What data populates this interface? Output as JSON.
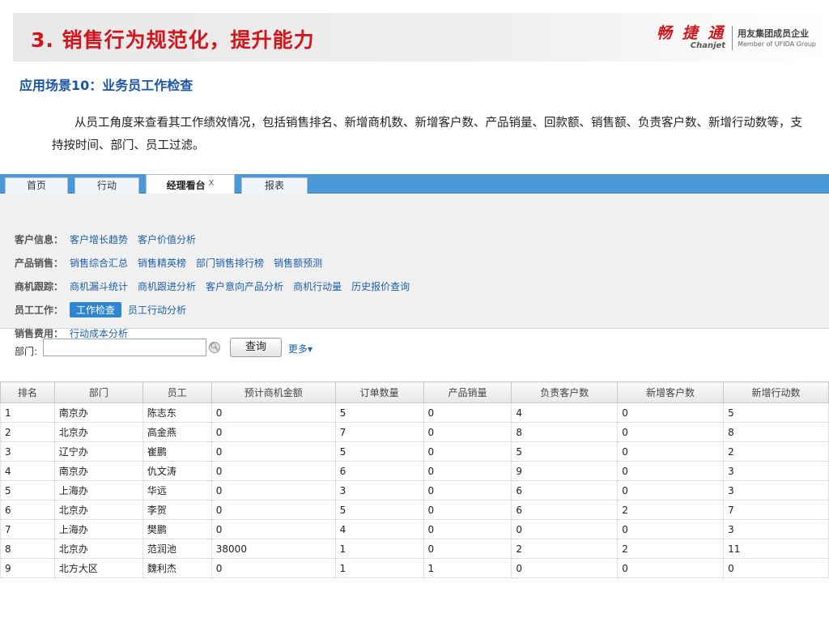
{
  "header": {
    "title": "3. 销售行为规范化，提升能力",
    "logo": {
      "name": "畅 捷 通",
      "sub": "Chanjet",
      "group_cn": "用友集团成员企业",
      "group_en": "Member of UFIDA Group"
    }
  },
  "subtitle": "应用场景10：业务员工作检查",
  "paragraph": "从员工角度来查看其工作绩效情况，包括销售排名、新增商机数、新增客户数、产品销量、回款额、销售额、负责客户数、新增行动数等，支持按时间、部门、员工过滤。",
  "tabs": [
    {
      "label": "首页"
    },
    {
      "label": "行动"
    },
    {
      "label": "经理看台",
      "close": "X"
    },
    {
      "label": "报表"
    }
  ],
  "nav": {
    "row1": {
      "label": "客户信息：",
      "links": [
        "客户增长趋势",
        "客户价值分析"
      ]
    },
    "row2": {
      "label": "产品销售：",
      "links": [
        "销售综合汇总",
        "销售精英榜",
        "部门销售排行榜",
        "销售额预测"
      ]
    },
    "row3": {
      "label": "商机跟踪：",
      "links": [
        "商机漏斗统计",
        "商机跟进分析",
        "客户意向产品分析",
        "商机行动量",
        "历史报价查询"
      ]
    },
    "row4": {
      "label": "员工工作：",
      "links": [
        "工作检查",
        "员工行动分析"
      ]
    },
    "row5": {
      "label": "销售费用：",
      "links": [
        "行动成本分析"
      ]
    }
  },
  "filter": {
    "dept_label": "部门:",
    "dept_value": "",
    "query_label": "查询",
    "more_label": "更多▾"
  },
  "table": {
    "columns": [
      "排名",
      "部门",
      "员工",
      "预计商机金额",
      "订单数量",
      "产品销量",
      "负责客户数",
      "新增客户数",
      "新增行动数"
    ],
    "rows": [
      [
        "1",
        "南京办",
        "陈志东",
        "0",
        "5",
        "0",
        "4",
        "0",
        "5"
      ],
      [
        "2",
        "北京办",
        "高金燕",
        "0",
        "7",
        "0",
        "8",
        "0",
        "8"
      ],
      [
        "3",
        "辽宁办",
        "崔鹏",
        "0",
        "5",
        "0",
        "5",
        "0",
        "2"
      ],
      [
        "4",
        "南京办",
        "仇文涛",
        "0",
        "6",
        "0",
        "9",
        "0",
        "3"
      ],
      [
        "5",
        "上海办",
        "华远",
        "0",
        "3",
        "0",
        "6",
        "0",
        "3"
      ],
      [
        "6",
        "北京办",
        "李贺",
        "0",
        "5",
        "0",
        "6",
        "2",
        "7"
      ],
      [
        "7",
        "上海办",
        "樊鹏",
        "0",
        "4",
        "0",
        "0",
        "0",
        "3"
      ],
      [
        "8",
        "北京办",
        "范润池",
        "38000",
        "1",
        "0",
        "2",
        "2",
        "11"
      ],
      [
        "9",
        "北方大区",
        "魏利杰",
        "0",
        "1",
        "1",
        "0",
        "0",
        "0"
      ]
    ]
  }
}
